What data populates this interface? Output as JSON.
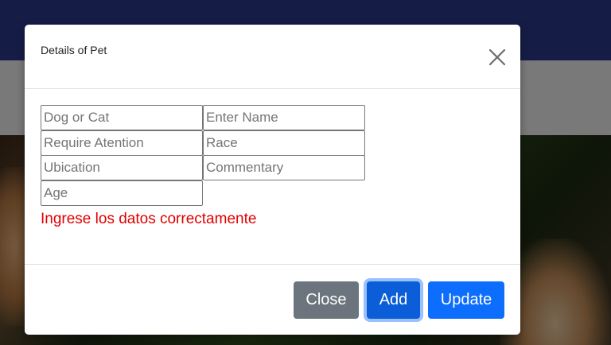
{
  "modal": {
    "title": "Details of Pet",
    "close_icon": "close-icon"
  },
  "form": {
    "type_placeholder": "Dog or Cat",
    "name_placeholder": "Enter Name",
    "attention_placeholder": "Require Atention",
    "race_placeholder": "Race",
    "location_placeholder": "Ubication",
    "comment_placeholder": "Commentary",
    "age_placeholder": "Age",
    "error_message": "Ingrese los datos correctamente"
  },
  "footer": {
    "close_label": "Close",
    "add_label": "Add",
    "update_label": "Update"
  },
  "colors": {
    "header_bg": "#2a3a8e",
    "error": "#e00000",
    "btn_secondary": "#6c757d",
    "btn_primary_active": "#0b5ed7",
    "btn_primary": "#0d6efd"
  }
}
